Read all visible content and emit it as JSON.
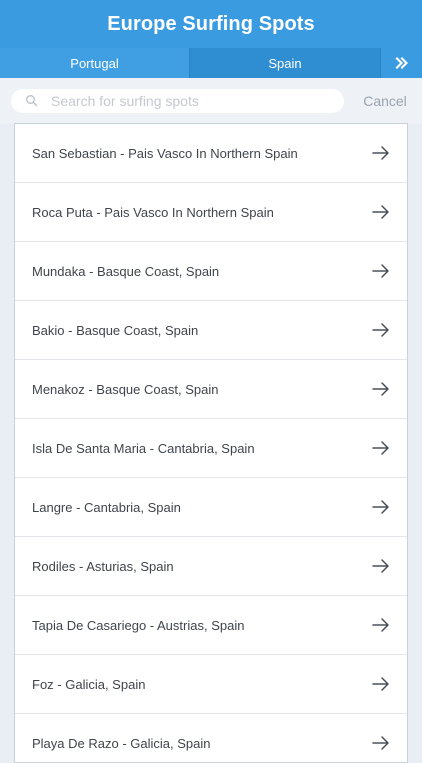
{
  "header": {
    "title": "Europe Surfing Spots"
  },
  "tabs": [
    {
      "label": "Portugal",
      "selected": false
    },
    {
      "label": "Spain",
      "selected": true
    }
  ],
  "tabs_next_icon": "double-chevron-right-icon",
  "search": {
    "placeholder": "Search for surfing spots",
    "value": "",
    "cancel_label": "Cancel"
  },
  "spots": [
    "San Sebastian - Pais Vasco In Northern Spain",
    "Roca Puta - Pais Vasco In Northern Spain",
    "Mundaka - Basque Coast, Spain",
    "Bakio - Basque Coast, Spain",
    "Menakoz - Basque Coast, Spain",
    "Isla De Santa Maria - Cantabria, Spain",
    "Langre - Cantabria, Spain",
    "Rodiles - Asturias, Spain",
    "Tapia De Casariego - Austrias, Spain",
    "Foz - Galicia, Spain",
    "Playa De Razo - Galicia, Spain"
  ],
  "colors": {
    "header": "#3a9be0",
    "tab_selected": "#2f8dd2",
    "background": "#e9eef4",
    "text": "#3f454c",
    "cancel": "#9aa3ad"
  }
}
